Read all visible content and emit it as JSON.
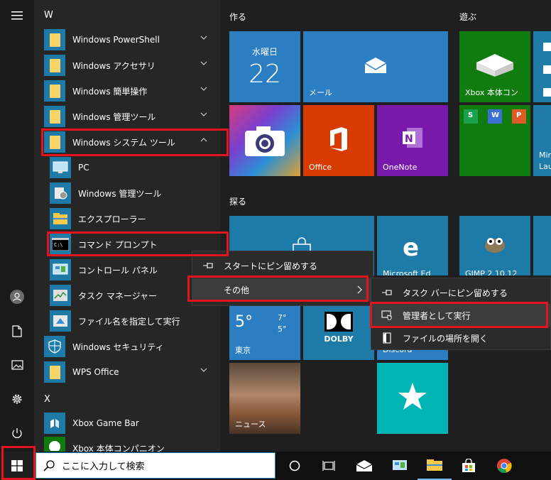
{
  "applist": {
    "letter_w": "W",
    "letter_x": "X",
    "items": [
      {
        "label": "Windows PowerShell"
      },
      {
        "label": "Windows アクセサリ"
      },
      {
        "label": "Windows 簡単操作"
      },
      {
        "label": "Windows 管理ツール"
      },
      {
        "label": "Windows システム ツール"
      },
      {
        "label": "PC"
      },
      {
        "label": "Windows 管理ツール"
      },
      {
        "label": "エクスプローラー"
      },
      {
        "label": "コマンド プロンプト"
      },
      {
        "label": "コントロール パネル"
      },
      {
        "label": "タスク マネージャー"
      },
      {
        "label": "ファイル名を指定して実行"
      },
      {
        "label": "Windows セキュリティ"
      },
      {
        "label": "WPS Office"
      },
      {
        "label": "Xbox Game Bar"
      },
      {
        "label": "Xbox 本体コンパニオン"
      }
    ]
  },
  "groups": {
    "create": "作る",
    "play": "遊ぶ",
    "explore": "探る"
  },
  "tiles": {
    "calendar_day": "水曜日",
    "calendar_date": "22",
    "mail": "メール",
    "office": "Office",
    "onenote": "OneNote",
    "xbox": "Xbox 本体コン",
    "mini_partial": "Mir",
    "lau_partial": "Lau",
    "edge_partial": "Microsoft Ed",
    "gimp_partial": "GIMP 2.10.12",
    "weather_temp": "5°",
    "weather_hi": "7°",
    "weather_lo": "5°",
    "weather_city": "東京",
    "dolby": "DOLBY",
    "discord_partial": "Discord",
    "news": "ニュース"
  },
  "context_menu": {
    "pin_start": "スタートにピン留めする",
    "more": "その他"
  },
  "submenu": {
    "pin_taskbar": "タスク バーにピン留めする",
    "run_admin": "管理者として実行",
    "open_location": "ファイルの場所を開く"
  },
  "taskbar": {
    "search_placeholder": "ここに入力して検索"
  },
  "colors": {
    "accent": "#1e7ba8",
    "highlight": "#e3141e",
    "tile_blue": "#2b7ec1",
    "office_orange": "#d83b01",
    "onenote_purple": "#7719aa",
    "xbox_green": "#107c10",
    "discord_teal": "#00b4b4"
  }
}
